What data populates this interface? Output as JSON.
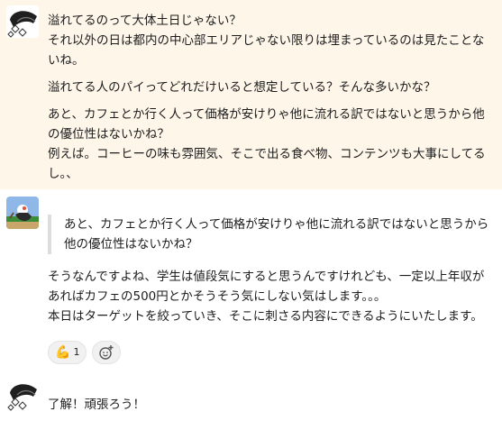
{
  "messages": [
    {
      "paragraphs": [
        "溢れてるのって大体土日じゃない？\nそれ以外の日は都内の中心部エリアじゃない限りは埋まっているのは見たことないね。",
        "溢れてる人のパイってどれだけいると想定している？そんな多いかな？",
        "あと、カフェとか行く人って価格が安けりゃ他に流れる訳ではないと思うから他の優位性はないかね？\n例えば。コーヒーの味も雰囲気、そこで出る食べ物、コンテンツも大事にしてるし。、"
      ]
    },
    {
      "quote": "あと、カフェとか行く人って価格が安けりゃ他に流れる訳ではないと思うから他の優位性はないかね？",
      "paragraphs": [
        "そうなんですよね、学生は値段気にすると思うんですけれども、一定以上年収があればカフェの500円とかそうそう気にしない気はします。。。\n本日はターゲットを絞っていき、そこに刺さる内容にできるようにいたします。"
      ],
      "reactions": [
        {
          "emoji": "💪",
          "count": "1",
          "icon": "flexed-biceps"
        },
        {
          "icon": "add-reaction"
        }
      ]
    },
    {
      "paragraphs": [
        "了解！頑張ろう！"
      ]
    }
  ],
  "colors": {
    "highlight": "#fdf6e9",
    "quote_bar": "#dddddd"
  }
}
